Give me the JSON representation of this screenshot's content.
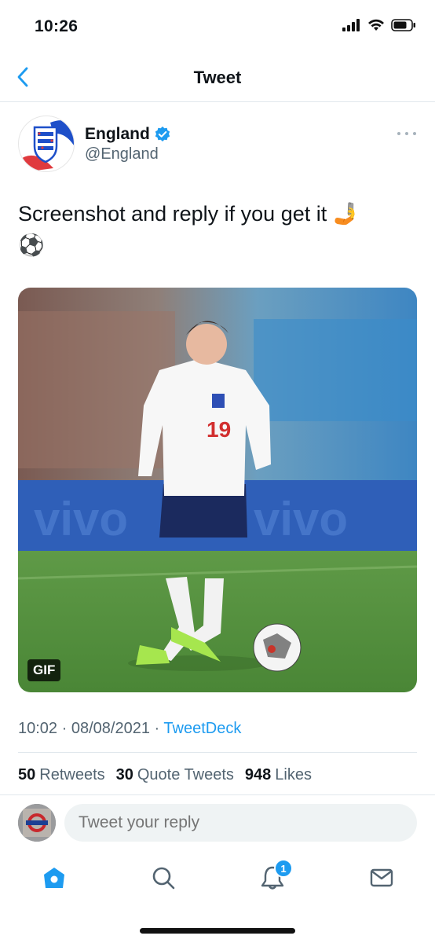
{
  "status_bar": {
    "time": "10:26"
  },
  "nav": {
    "title": "Tweet"
  },
  "tweet": {
    "author_name": "England",
    "author_handle": "@England",
    "text": "Screenshot and reply if you get it 🤳",
    "text_line2": "⚽",
    "media_badge": "GIF",
    "jersey_number": "19",
    "time": "10:02",
    "date": "08/08/2021",
    "source": "TweetDeck",
    "separator": "·"
  },
  "stats": {
    "retweets_count": "50",
    "retweets_label": "Retweets",
    "quotes_count": "30",
    "quotes_label": "Quote Tweets",
    "likes_count": "948",
    "likes_label": "Likes"
  },
  "reply": {
    "placeholder": "Tweet your reply"
  },
  "tabs": {
    "notifications_badge": "1"
  },
  "colors": {
    "accent": "#1d9bf0",
    "secondary_text": "#536471",
    "verified": "#1d9bf0"
  },
  "icons": [
    "back-chevron-icon",
    "verified-badge-icon",
    "more-icon",
    "home-icon",
    "search-icon",
    "bell-icon",
    "mail-icon",
    "signal-icon",
    "wifi-icon",
    "battery-icon"
  ]
}
